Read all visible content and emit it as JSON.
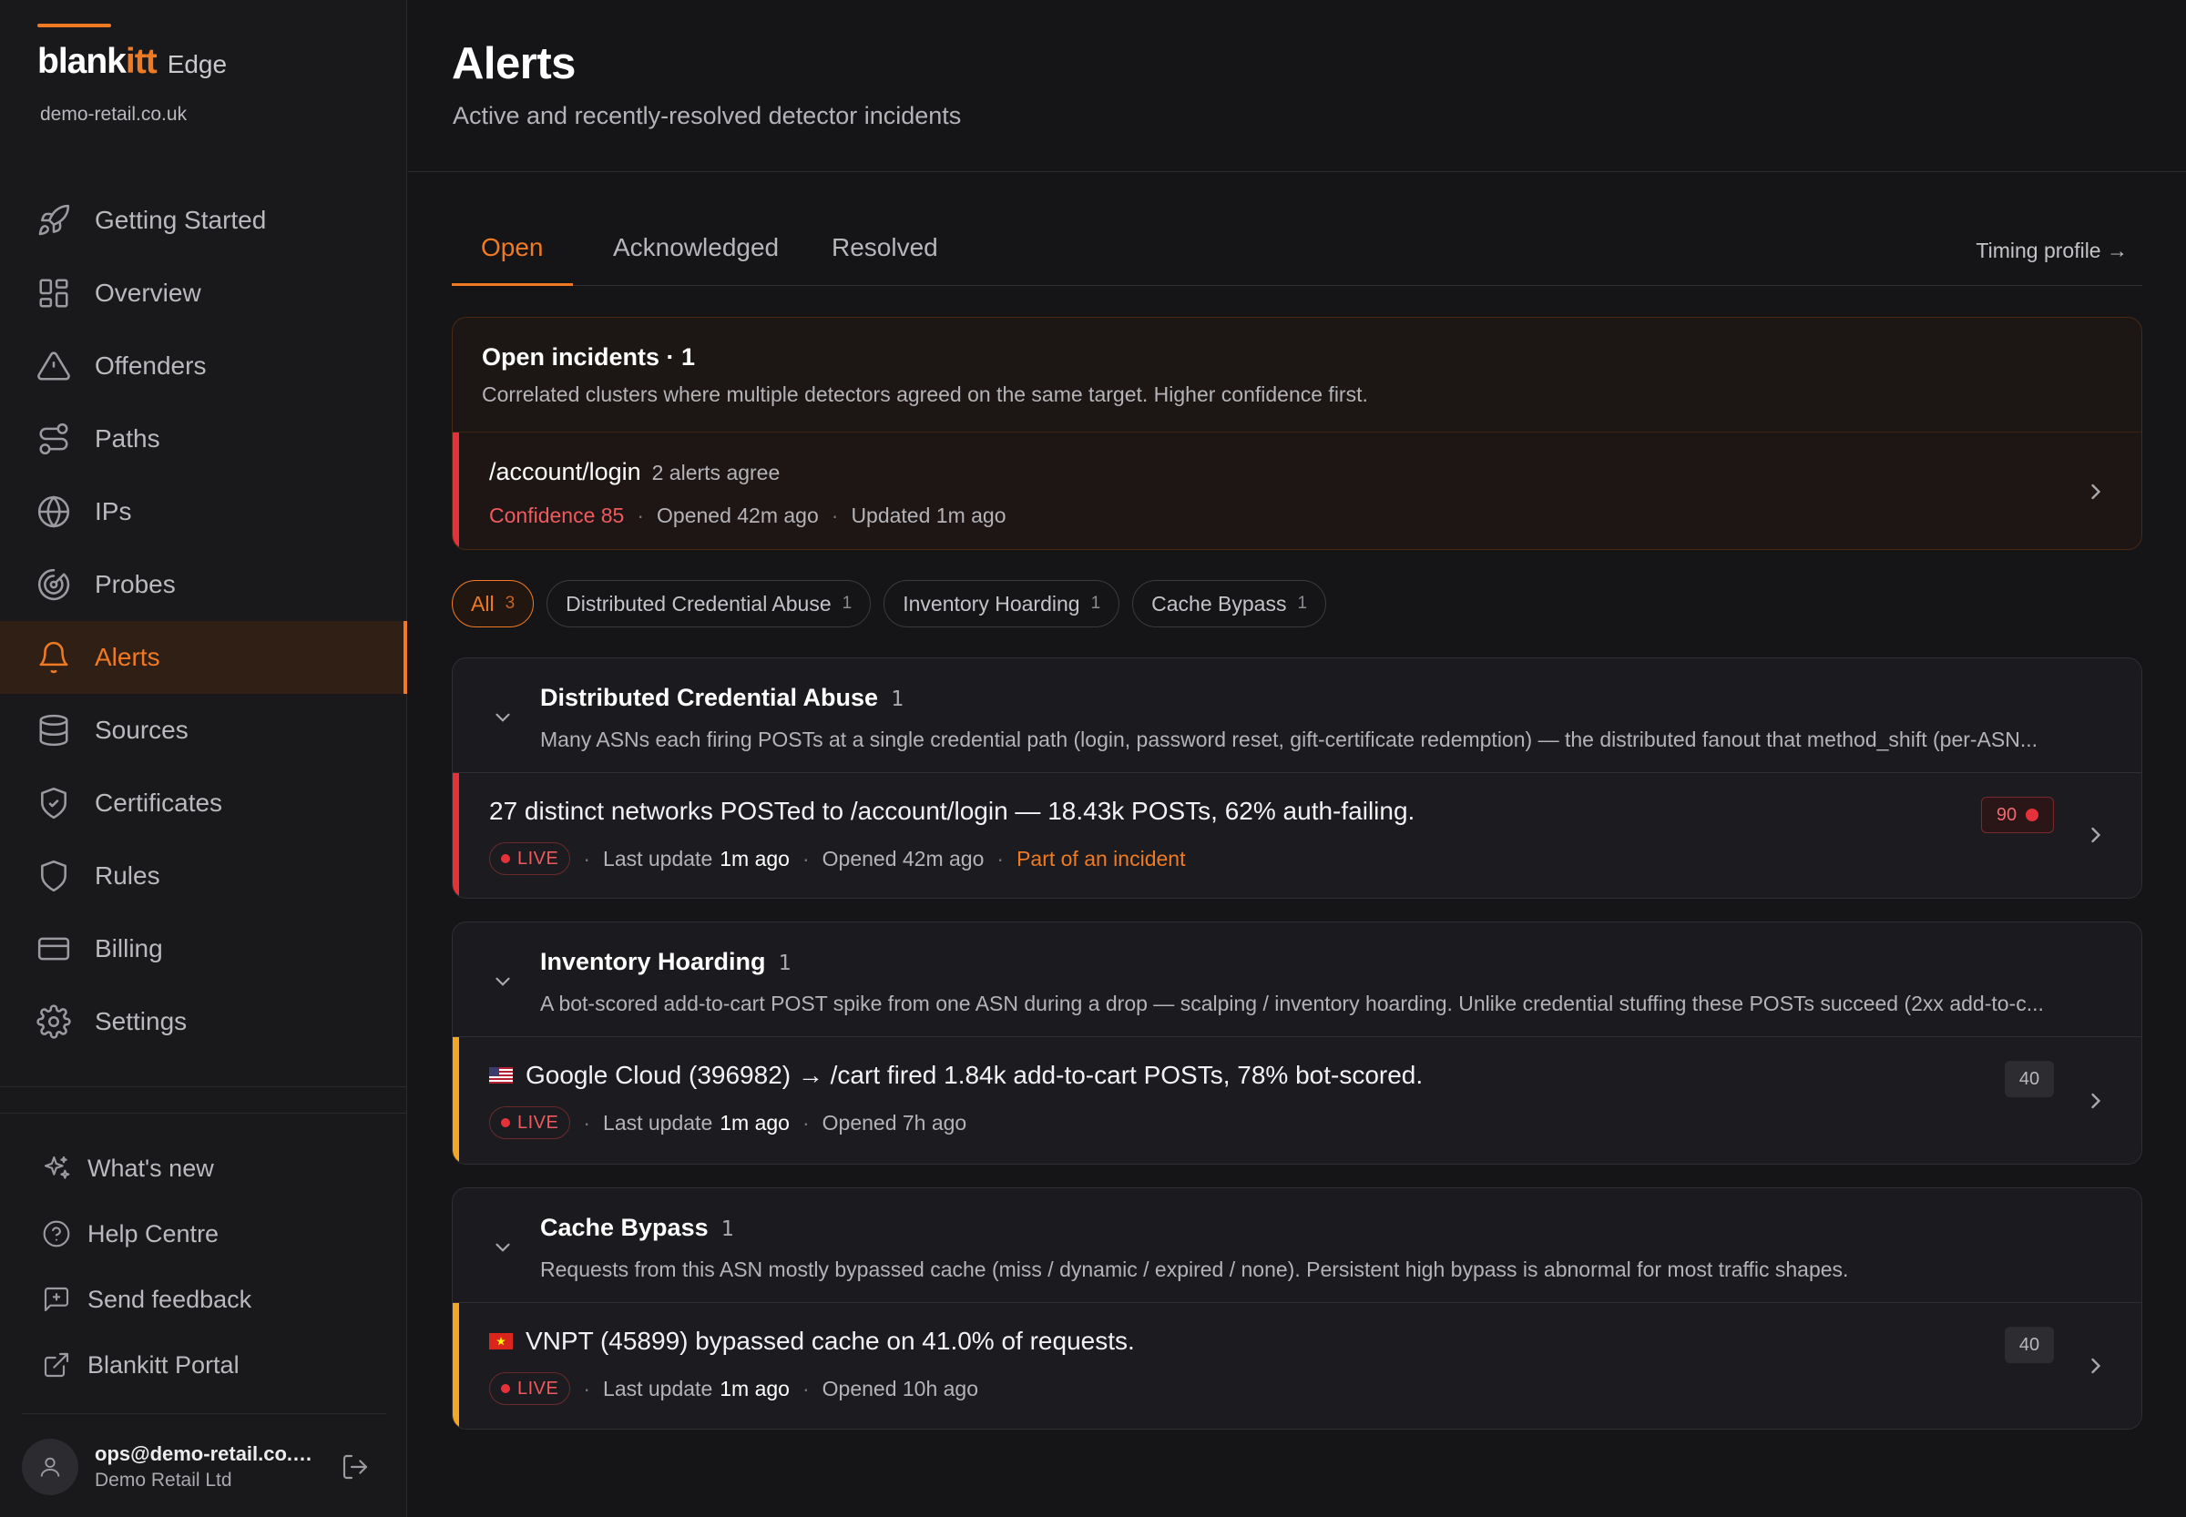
{
  "brand": {
    "name_a": "blank",
    "name_b": "itt",
    "product": "Edge",
    "domain": "demo-retail.co.uk",
    "accent": "#f07a23"
  },
  "nav": {
    "items": [
      {
        "label": "Getting Started"
      },
      {
        "label": "Overview"
      },
      {
        "label": "Offenders"
      },
      {
        "label": "Paths"
      },
      {
        "label": "IPs"
      },
      {
        "label": "Probes"
      },
      {
        "label": "Alerts",
        "active": true
      },
      {
        "label": "Sources"
      },
      {
        "label": "Certificates"
      },
      {
        "label": "Rules"
      },
      {
        "label": "Billing"
      },
      {
        "label": "Settings"
      }
    ],
    "footer": [
      {
        "label": "What's new"
      },
      {
        "label": "Help Centre"
      },
      {
        "label": "Send feedback"
      },
      {
        "label": "Blankitt Portal"
      }
    ]
  },
  "user": {
    "email": "ops@demo-retail.co.uk",
    "org": "Demo Retail Ltd"
  },
  "page": {
    "title": "Alerts",
    "subtitle": "Active and recently-resolved detector incidents"
  },
  "tabs": [
    {
      "label": "Open",
      "active": true
    },
    {
      "label": "Acknowledged"
    },
    {
      "label": "Resolved"
    }
  ],
  "timing_link": "Timing profile →",
  "incidents": {
    "title": "Open incidents · 1",
    "description": "Correlated clusters where multiple detectors agreed on the same target. Higher confidence first.",
    "items": [
      {
        "path": "/account/login",
        "agree": "2 alerts agree",
        "confidence": "Confidence 85",
        "opened": "Opened 42m ago",
        "updated": "Updated 1m ago"
      }
    ]
  },
  "filters": [
    {
      "label": "All",
      "count": "3",
      "active": true
    },
    {
      "label": "Distributed Credential Abuse",
      "count": "1"
    },
    {
      "label": "Inventory Hoarding",
      "count": "1"
    },
    {
      "label": "Cache Bypass",
      "count": "1"
    }
  ],
  "groups": [
    {
      "title": "Distributed Credential Abuse",
      "count": "1",
      "description": "Many ASNs each firing POSTs at a single credential path (login, password reset, gift-certificate redemption) — the distributed fanout that method_shift (per-ASN...",
      "alert": {
        "title": "27 distinct networks POSTed to /account/login — 18.43k POSTs, 62% auth-failing.",
        "live": "LIVE",
        "last_update_label": "Last update",
        "last_update": "1m ago",
        "opened": "Opened 42m ago",
        "incident_link": "Part of an incident",
        "score": "90",
        "severity_color": "#e5323a"
      }
    },
    {
      "title": "Inventory Hoarding",
      "count": "1",
      "description": "A bot-scored add-to-cart POST spike from one ASN during a drop — scalping / inventory hoarding. Unlike credential stuffing these POSTs succeed (2xx add-to-c...",
      "alert": {
        "flag": "us-flag",
        "title": "Google Cloud (396982) → /cart fired 1.84k add-to-cart POSTs, 78% bot-scored.",
        "live": "LIVE",
        "last_update_label": "Last update",
        "last_update": "1m ago",
        "opened": "Opened 7h ago",
        "score": "40",
        "severity_color": "#f5a623"
      }
    },
    {
      "title": "Cache Bypass",
      "count": "1",
      "description": "Requests from this ASN mostly bypassed cache (miss / dynamic / expired / none). Persistent high bypass is abnormal for most traffic shapes.",
      "alert": {
        "flag": "vn-flag",
        "title": "VNPT (45899) bypassed cache on 41.0% of requests.",
        "live": "LIVE",
        "last_update_label": "Last update",
        "last_update": "1m ago",
        "opened": "Opened 10h ago",
        "score": "40",
        "severity_color": "#f5a623"
      }
    }
  ]
}
